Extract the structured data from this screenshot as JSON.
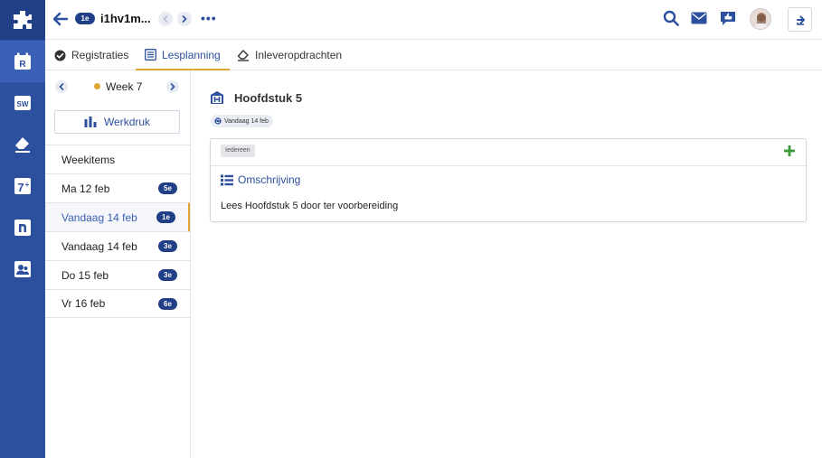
{
  "topbar": {
    "class_badge": "1e",
    "title": "i1hv1m...",
    "more": "•••"
  },
  "tabs": [
    {
      "label": "Registraties",
      "icon": "check-circle-icon"
    },
    {
      "label": "Lesplanning",
      "icon": "list-icon",
      "active": true
    },
    {
      "label": "Inleveropdrachten",
      "icon": "eraser-icon"
    }
  ],
  "sidebar": {
    "week_label": "Week 7",
    "werkdruk_label": "Werkdruk",
    "items": [
      {
        "label": "Weekitems",
        "badge": ""
      },
      {
        "label": "Ma 12 feb",
        "badge": "5e"
      },
      {
        "label": "Vandaag 14 feb",
        "badge": "1e",
        "selected": true
      },
      {
        "label": "Vandaag 14 feb",
        "badge": "3e"
      },
      {
        "label": "Do 15 feb",
        "badge": "3e"
      },
      {
        "label": "Vr 16 feb",
        "badge": "6e"
      }
    ]
  },
  "main": {
    "title": "Hoofdstuk 5",
    "date_pill": "Vandaag 14 feb",
    "card": {
      "tag": "Iedereen",
      "section_label": "Omschrijving",
      "description": "Lees Hoofdstuk 5 door ter voorbereiding"
    }
  },
  "colors": {
    "brand": "#2c4f9e",
    "brand_dark": "#203f86",
    "accent": "#e0a635",
    "add": "#3a9a3a"
  }
}
